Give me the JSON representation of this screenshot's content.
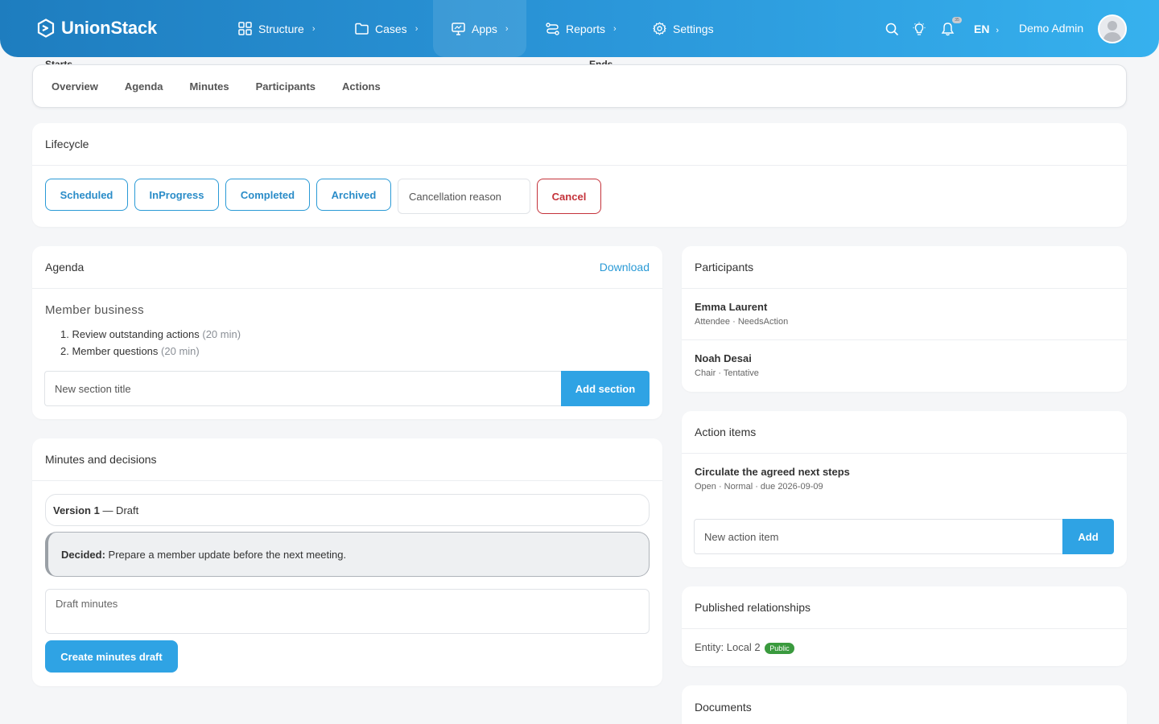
{
  "brand": {
    "name": "UnionStack"
  },
  "nav": {
    "items": [
      {
        "label": "Structure",
        "icon": "grid-icon"
      },
      {
        "label": "Cases",
        "icon": "folder-icon"
      },
      {
        "label": "Apps",
        "icon": "monitor-icon"
      },
      {
        "label": "Reports",
        "icon": "route-icon"
      },
      {
        "label": "Settings",
        "icon": "gear-icon"
      }
    ],
    "notification_count": "35",
    "language": "EN",
    "user_name": "Demo Admin"
  },
  "peek": {
    "starts": "Starts",
    "ends": "Ends"
  },
  "tabs": [
    "Overview",
    "Agenda",
    "Minutes",
    "Participants",
    "Actions"
  ],
  "lifecycle": {
    "title": "Lifecycle",
    "states": [
      "Scheduled",
      "InProgress",
      "Completed",
      "Archived"
    ],
    "cancel_placeholder": "Cancellation reason",
    "cancel_label": "Cancel"
  },
  "agenda": {
    "title": "Agenda",
    "download_label": "Download",
    "section_title": "Member business",
    "items": [
      {
        "num": "1.",
        "text": "Review outstanding actions",
        "duration": "(20 min)"
      },
      {
        "num": "2.",
        "text": "Member questions",
        "duration": "(20 min)"
      }
    ],
    "new_section_placeholder": "New section title",
    "add_section_label": "Add section"
  },
  "minutes": {
    "title": "Minutes and decisions",
    "version_label": "Version 1",
    "version_status": "— Draft",
    "decided_label": "Decided:",
    "decided_text": "Prepare a member update before the next meeting.",
    "draft_placeholder": "Draft minutes",
    "create_label": "Create minutes draft"
  },
  "participants": {
    "title": "Participants",
    "people": [
      {
        "name": "Emma Laurent",
        "role": "Attendee · NeedsAction"
      },
      {
        "name": "Noah Desai",
        "role": "Chair · Tentative"
      }
    ]
  },
  "actions": {
    "title": "Action items",
    "item_title": "Circulate the agreed next steps",
    "item_meta": "Open · Normal · due 2026-09-09",
    "new_placeholder": "New action item",
    "add_label": "Add"
  },
  "relationships": {
    "title": "Published relationships",
    "entity": "Entity: Local 2",
    "badge": "Public"
  },
  "documents": {
    "title": "Documents"
  }
}
